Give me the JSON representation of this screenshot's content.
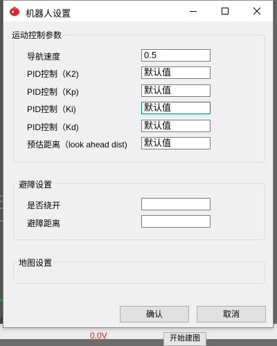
{
  "window": {
    "title": "机器人设置"
  },
  "motion_group": {
    "label": "运动控制参数",
    "rows": [
      {
        "label": "导航速度",
        "value": "0.5"
      },
      {
        "label": "PID控制（K2)",
        "value": "默认值"
      },
      {
        "label": "PID控制（Kp)",
        "value": "默认值"
      },
      {
        "label": "PID控制（Ki)",
        "value": "默认值"
      },
      {
        "label": "PID控制（Kd)",
        "value": "默认值"
      },
      {
        "label": "预估距离（look ahead dist)",
        "value": "默认值"
      }
    ]
  },
  "avoid_group": {
    "label": "避障设置",
    "rows": [
      {
        "label": "是否绕开",
        "value": ""
      },
      {
        "label": "避障距离",
        "value": ""
      }
    ]
  },
  "map_group": {
    "label": "地图设置"
  },
  "buttons": {
    "ok": "确认",
    "cancel": "取消"
  },
  "background": {
    "red_text": "0.0V",
    "button_text": "开始建图",
    "glyph": "隔"
  },
  "colors": {
    "focus_border": "#0078d7",
    "icon_red": "#d7262b"
  }
}
